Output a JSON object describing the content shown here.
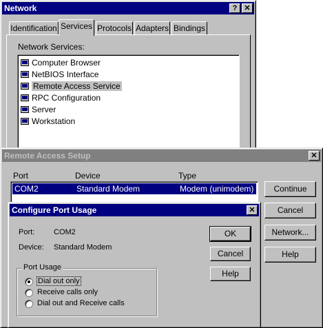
{
  "network": {
    "title": "Network",
    "help_glyph": "?",
    "close_glyph": "✕",
    "tabs": [
      "Identification",
      "Services",
      "Protocols",
      "Adapters",
      "Bindings"
    ],
    "active_tab": "Services",
    "services_label": "Network Services:",
    "services": [
      "Computer Browser",
      "NetBIOS Interface",
      "Remote Access Service",
      "RPC Configuration",
      "Server",
      "Workstation"
    ],
    "selected_service": "Remote Access Service"
  },
  "ras": {
    "title": "Remote Access Setup",
    "close_glyph": "✕",
    "columns": [
      "Port",
      "Device",
      "Type"
    ],
    "row": {
      "port": "COM2",
      "device": "Standard Modem",
      "type": "Modem (unimodem)"
    },
    "buttons": {
      "continue": "Continue",
      "cancel": "Cancel",
      "network": "Network...",
      "help": "Help"
    }
  },
  "cpu": {
    "title": "Configure Port Usage",
    "close_glyph": "✕",
    "port_label": "Port:",
    "port_value": "COM2",
    "device_label": "Device:",
    "device_value": "Standard Modem",
    "group_label": "Port Usage",
    "options": [
      "Dial out only",
      "Receive calls only",
      "Dial out and Receive calls"
    ],
    "selected_option": "Dial out only",
    "buttons": {
      "ok": "OK",
      "cancel": "Cancel",
      "help": "Help"
    }
  },
  "colors": {
    "title_active": "#000080",
    "title_inactive": "#808080",
    "face": "#c0c0c0"
  }
}
